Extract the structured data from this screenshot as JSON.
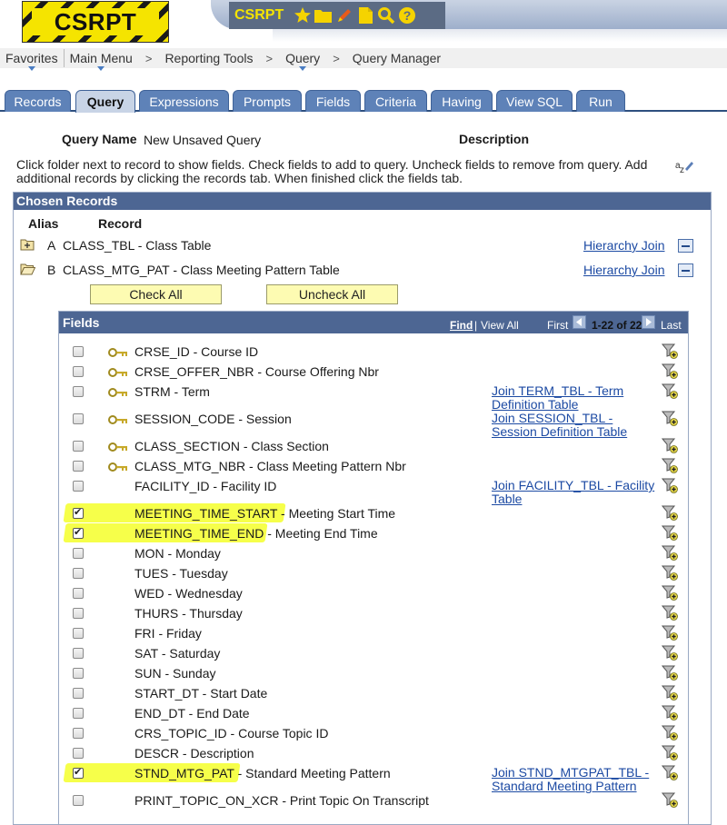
{
  "app": {
    "logo_text": "CSRPT",
    "toolbar_title": "CSRPT"
  },
  "toolbar_icons": [
    "star-icon",
    "folder-icon",
    "pencil-icon",
    "document-icon",
    "search-icon",
    "help-icon"
  ],
  "breadcrumb": {
    "favorites": "Favorites",
    "main_menu": "Main Menu",
    "reporting_tools": "Reporting Tools",
    "query": "Query",
    "query_manager": "Query Manager",
    "sep": ">"
  },
  "tabs": [
    {
      "label": "Records",
      "active": false
    },
    {
      "label": "Query",
      "active": true
    },
    {
      "label": "Expressions",
      "active": false
    },
    {
      "label": "Prompts",
      "active": false
    },
    {
      "label": "Fields",
      "active": false
    },
    {
      "label": "Criteria",
      "active": false
    },
    {
      "label": "Having",
      "active": false
    },
    {
      "label": "View SQL",
      "active": false
    },
    {
      "label": "Run",
      "active": false
    }
  ],
  "query": {
    "name_label": "Query Name",
    "name_value": "New Unsaved Query",
    "description_label": "Description",
    "instructions": "Click folder next to record to show fields. Check fields to add to query. Uncheck fields to remove from query. Add additional records by clicking the records tab. When finished click the fields tab."
  },
  "chosen_records": {
    "title": "Chosen Records",
    "alias_header": "Alias",
    "record_header": "Record",
    "records": [
      {
        "alias": "A",
        "record": "CLASS_TBL - Class Table",
        "join": "Hierarchy Join"
      },
      {
        "alias": "B",
        "record": "CLASS_MTG_PAT - Class Meeting Pattern Table",
        "join": "Hierarchy Join"
      }
    ],
    "check_all": "Check All",
    "uncheck_all": "Uncheck All"
  },
  "fields_grid": {
    "title": "Fields",
    "find": "Find",
    "divider": "|",
    "view_all": "View All",
    "first": "First",
    "range": "1-22 of 22",
    "last": "Last",
    "rows": [
      {
        "field": "CRSE_ID - Course ID",
        "checked": false,
        "key": true,
        "join": ""
      },
      {
        "field": "CRSE_OFFER_NBR - Course Offering Nbr",
        "checked": false,
        "key": true,
        "join": ""
      },
      {
        "field": "STRM - Term",
        "checked": false,
        "key": true,
        "join": "Join TERM_TBL - Term Definition Table"
      },
      {
        "field": "SESSION_CODE - Session",
        "checked": false,
        "key": true,
        "join": "Join SESSION_TBL - Session Definition Table"
      },
      {
        "field": "CLASS_SECTION - Class Section",
        "checked": false,
        "key": true,
        "join": ""
      },
      {
        "field": "CLASS_MTG_NBR - Class Meeting Pattern Nbr",
        "checked": false,
        "key": true,
        "join": ""
      },
      {
        "field": "FACILITY_ID - Facility ID",
        "checked": false,
        "key": false,
        "join": "Join FACILITY_TBL - Facility Table"
      },
      {
        "field": "MEETING_TIME_START - Meeting Start Time",
        "checked": true,
        "key": false,
        "join": ""
      },
      {
        "field": "MEETING_TIME_END - Meeting End Time",
        "checked": true,
        "key": false,
        "join": ""
      },
      {
        "field": "MON - Monday",
        "checked": false,
        "key": false,
        "join": ""
      },
      {
        "field": "TUES - Tuesday",
        "checked": false,
        "key": false,
        "join": ""
      },
      {
        "field": "WED - Wednesday",
        "checked": false,
        "key": false,
        "join": ""
      },
      {
        "field": "THURS - Thursday",
        "checked": false,
        "key": false,
        "join": ""
      },
      {
        "field": "FRI - Friday",
        "checked": false,
        "key": false,
        "join": ""
      },
      {
        "field": "SAT - Saturday",
        "checked": false,
        "key": false,
        "join": ""
      },
      {
        "field": "SUN - Sunday",
        "checked": false,
        "key": false,
        "join": ""
      },
      {
        "field": "START_DT - Start Date",
        "checked": false,
        "key": false,
        "join": ""
      },
      {
        "field": "END_DT - End Date",
        "checked": false,
        "key": false,
        "join": ""
      },
      {
        "field": "CRS_TOPIC_ID - Course Topic ID",
        "checked": false,
        "key": false,
        "join": ""
      },
      {
        "field": "DESCR - Description",
        "checked": false,
        "key": false,
        "join": ""
      },
      {
        "field": "STND_MTG_PAT - Standard Meeting Pattern",
        "checked": true,
        "key": false,
        "join": "Join STND_MTGPAT_TBL - Standard Meeting Pattern"
      },
      {
        "field": "PRINT_TOPIC_ON_XCR - Print Topic On Transcript",
        "checked": false,
        "key": false,
        "join": ""
      }
    ]
  },
  "colors": {
    "header_blue": "#4d6693",
    "tab_blue": "#5e82b8",
    "highlight_yellow": "#f5ff36",
    "link_blue": "#1c4aa3"
  }
}
